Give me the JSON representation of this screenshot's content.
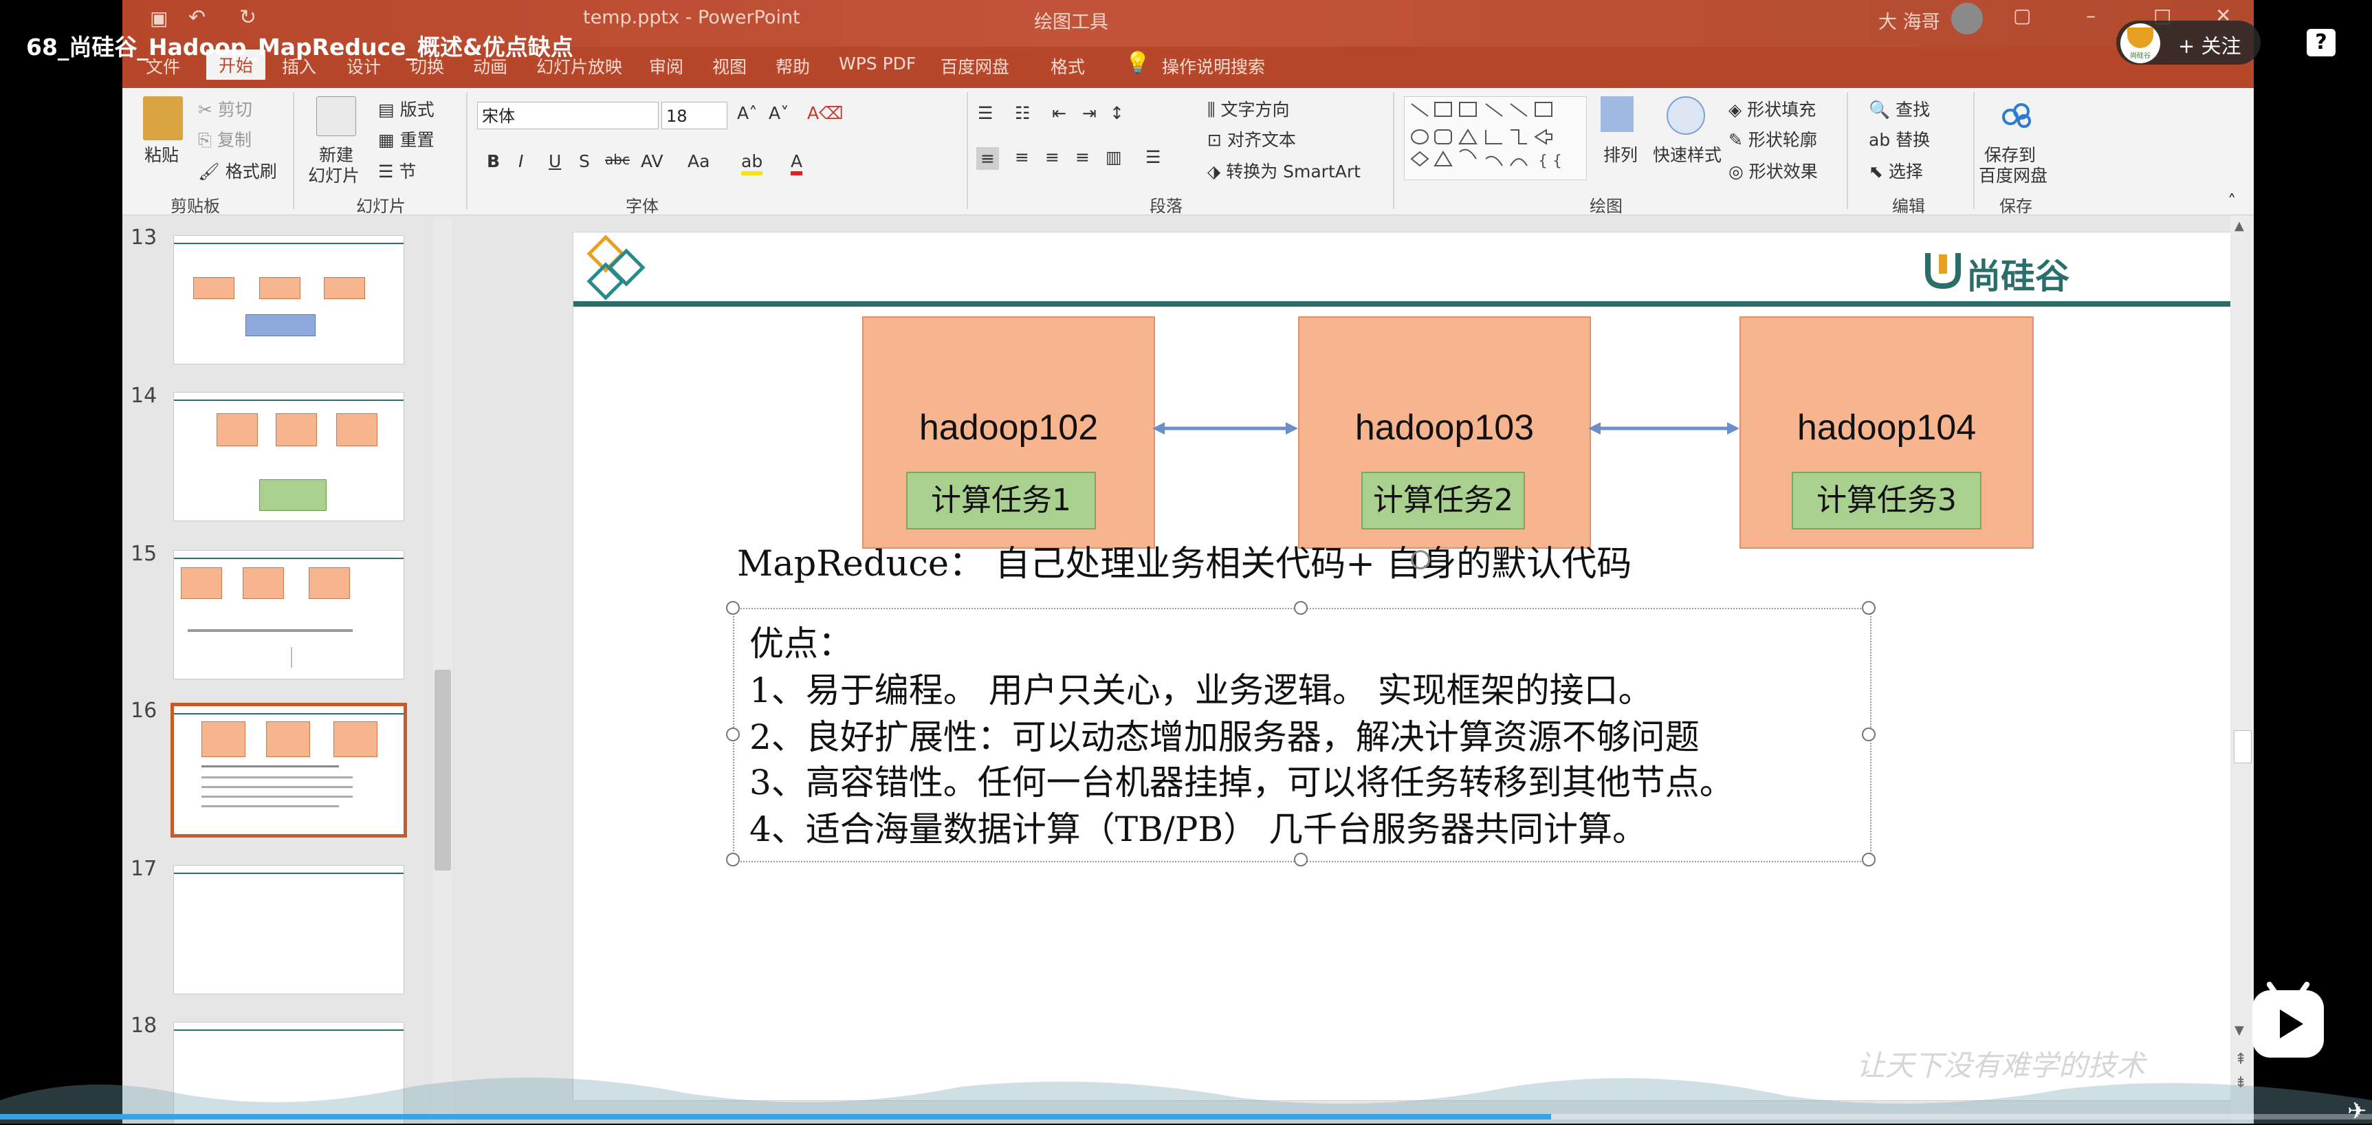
{
  "video": {
    "title": "68_尚硅谷_Hadoop_MapReduce_概述&优点缺点",
    "follow_label": "+ 关注",
    "help": "?",
    "avatar_text": "尚硅谷",
    "progress": 0.654
  },
  "window": {
    "doc_title": "temp.pptx - PowerPoint",
    "context_title": "绘图工具",
    "user": "大 海哥"
  },
  "tabs": [
    "文件",
    "开始",
    "插入",
    "设计",
    "切换",
    "动画",
    "幻灯片放映",
    "审阅",
    "视图",
    "帮助",
    "WPS PDF",
    "百度网盘",
    "格式"
  ],
  "active_tab": "开始",
  "tell_me": "操作说明搜索",
  "ribbon": {
    "clipboard": {
      "paste": "粘贴",
      "cut": "剪切",
      "copy": "复制",
      "format_painter": "格式刷",
      "group": "剪贴板"
    },
    "slides": {
      "new": "新建",
      "new2": "幻灯片",
      "layout": "版式",
      "reset": "重置",
      "section": "节",
      "group": "幻灯片"
    },
    "font": {
      "name": "宋体",
      "size": "18",
      "group": "字体"
    },
    "paragraph": {
      "text_direction": "文字方向",
      "align_text": "对齐文本",
      "smartart": "转换为 SmartArt",
      "group": "段落"
    },
    "drawing": {
      "arrange": "排列",
      "quick_styles": "快速样式",
      "fill": "形状填充",
      "outline": "形状轮廓",
      "effects": "形状效果",
      "group": "绘图"
    },
    "editing": {
      "find": "查找",
      "replace": "替换",
      "select": "选择",
      "group": "编辑"
    },
    "save": {
      "label1": "保存到",
      "label2": "百度网盘",
      "group": "保存"
    }
  },
  "thumbnails": [
    {
      "num": "13"
    },
    {
      "num": "14"
    },
    {
      "num": "15"
    },
    {
      "num": "16"
    },
    {
      "num": "17"
    },
    {
      "num": "18"
    }
  ],
  "slide": {
    "logo_text": "尚硅谷",
    "nodes": [
      {
        "name": "hadoop102",
        "task": "计算任务1"
      },
      {
        "name": "hadoop103",
        "task": "计算任务2"
      },
      {
        "name": "hadoop104",
        "task": "计算任务3"
      }
    ],
    "mapreduce_line": "MapReduce：  自己处理业务相关代码+  自身的默认代码",
    "advantages_title": "优点：",
    "advantages": [
      "1、易于编程。  用户只关心，业务逻辑。  实现框架的接口。",
      "2、良好扩展性：可以动态增加服务器，解决计算资源不够问题",
      "3、高容错性。任何一台机器挂掉，可以将任务转移到其他节点。",
      "4、适合海量数据计算（TB/PB）  几千台服务器共同计算。"
    ],
    "watermark": "让天下没有难学的技术"
  },
  "colors": {
    "accent": "#b7472a",
    "teal": "#2a6e6a",
    "node": "#f6b48f",
    "task": "#a9d08e"
  }
}
